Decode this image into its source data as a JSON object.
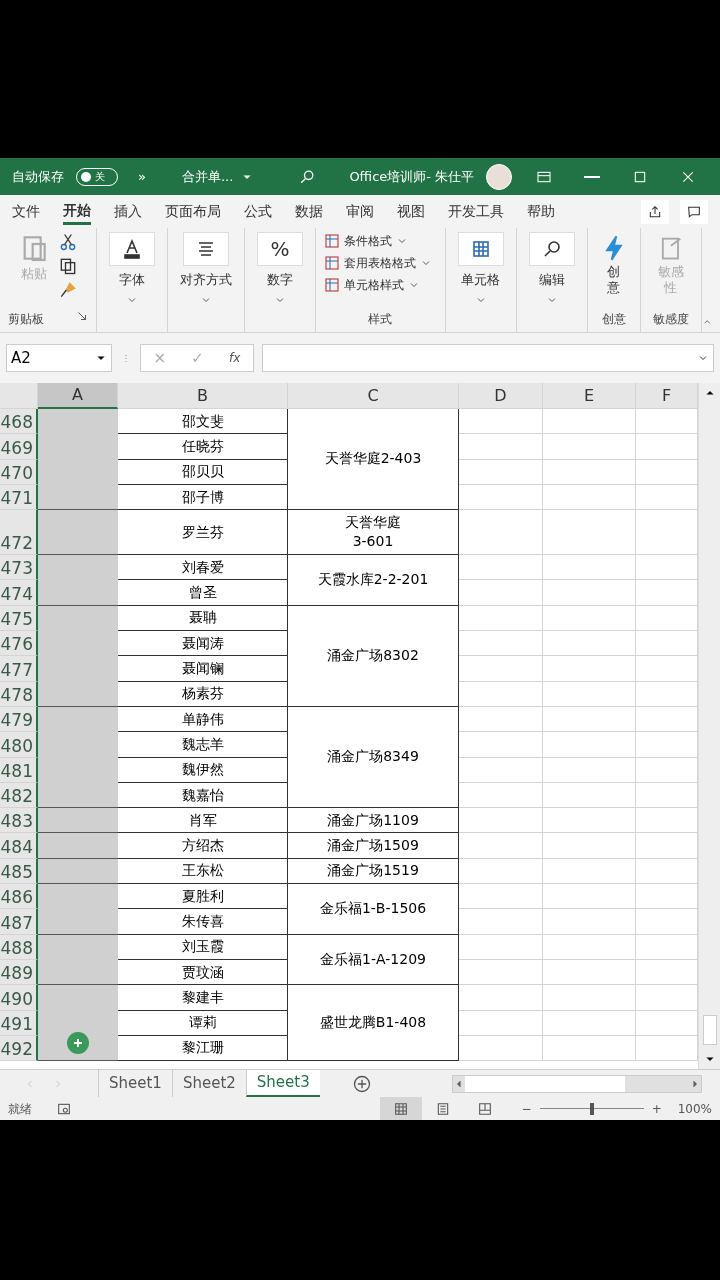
{
  "title_bar": {
    "autosave_label": "自动保存",
    "autosave_on": false,
    "autosave_state": "关",
    "more": "»",
    "file_name": "合并单...",
    "title": "Office培训师- 朱仕平"
  },
  "menu_tabs": [
    {
      "label": "文件",
      "selected": false
    },
    {
      "label": "开始",
      "selected": true
    },
    {
      "label": "插入",
      "selected": false
    },
    {
      "label": "页面布局",
      "selected": false
    },
    {
      "label": "公式",
      "selected": false
    },
    {
      "label": "数据",
      "selected": false
    },
    {
      "label": "审阅",
      "selected": false
    },
    {
      "label": "视图",
      "selected": false
    },
    {
      "label": "开发工具",
      "selected": false
    },
    {
      "label": "帮助",
      "selected": false
    }
  ],
  "ribbon": {
    "clipboard": {
      "paste": "粘贴",
      "paste_disabled": true,
      "label": "剪贴板"
    },
    "single_groups": [
      {
        "kind": "font",
        "label": "字体"
      },
      {
        "kind": "align",
        "label": "对齐方式"
      },
      {
        "kind": "number",
        "label": "数字",
        "symbol": "%"
      }
    ],
    "styles": {
      "items": [
        "条件格式",
        "套用表格格式",
        "单元格样式"
      ],
      "label": "样式"
    },
    "tail_groups": [
      {
        "kind": "cells",
        "label": "单元格"
      },
      {
        "kind": "edit",
        "label": "编辑"
      }
    ],
    "creative": {
      "button": [
        "创",
        "意"
      ],
      "label": "创意"
    },
    "sensitivity": {
      "button": [
        "敏感",
        "性"
      ],
      "disabled": true,
      "label": "敏感度"
    }
  },
  "formula_bar": {
    "name_box": "A2",
    "cancel": "×",
    "enter": "✓",
    "fx": "fx"
  },
  "columns": [
    {
      "label": "A",
      "selected": true
    },
    {
      "label": "B",
      "selected": false
    },
    {
      "label": "C",
      "selected": false
    },
    {
      "label": "D",
      "selected": false
    },
    {
      "label": "E",
      "selected": false
    },
    {
      "label": "F",
      "selected": false
    }
  ],
  "groups": [
    {
      "address": "天誉华庭2-403",
      "rows": [
        {
          "num": "468",
          "name": "邵文斐"
        },
        {
          "num": "469",
          "name": "任晓芬"
        },
        {
          "num": "470",
          "name": "邵贝贝"
        },
        {
          "num": "471",
          "name": "邵子博"
        }
      ]
    },
    {
      "address": "天誉华庭\n3-601",
      "tall": true,
      "rows": [
        {
          "num": "472",
          "name": "罗兰芬"
        }
      ]
    },
    {
      "address": "天霞水库2-2-201",
      "rows": [
        {
          "num": "473",
          "name": "刘春爱"
        },
        {
          "num": "474",
          "name": "曾圣"
        }
      ]
    },
    {
      "address": "涌金广场8302",
      "rows": [
        {
          "num": "475",
          "name": "聂聃"
        },
        {
          "num": "476",
          "name": "聂闻涛"
        },
        {
          "num": "477",
          "name": "聂闻镧"
        },
        {
          "num": "478",
          "name": "杨素芬"
        }
      ]
    },
    {
      "address": "涌金广场8349",
      "rows": [
        {
          "num": "479",
          "name": "单静伟"
        },
        {
          "num": "480",
          "name": "魏志羊"
        },
        {
          "num": "481",
          "name": "魏伊然"
        },
        {
          "num": "482",
          "name": "魏嘉怡"
        }
      ]
    },
    {
      "address": "涌金广场1109",
      "rows": [
        {
          "num": "483",
          "name": "肖军"
        }
      ]
    },
    {
      "address": "涌金广场1509",
      "rows": [
        {
          "num": "484",
          "name": "方绍杰"
        }
      ]
    },
    {
      "address": "涌金广场1519",
      "rows": [
        {
          "num": "485",
          "name": "王东松"
        }
      ]
    },
    {
      "address": "金乐福1-B-1506",
      "rows": [
        {
          "num": "486",
          "name": "夏胜利"
        },
        {
          "num": "487",
          "name": "朱传喜"
        }
      ]
    },
    {
      "address": "金乐福1-A-1209",
      "rows": [
        {
          "num": "488",
          "name": "刘玉霞"
        },
        {
          "num": "489",
          "name": "贾玟涵"
        }
      ]
    },
    {
      "address": "盛世龙腾B1-408",
      "cursor": true,
      "rows": [
        {
          "num": "490",
          "name": "黎建丰"
        },
        {
          "num": "491",
          "name": "谭莉"
        },
        {
          "num": "492",
          "name": "黎江珊"
        }
      ]
    }
  ],
  "sheet_tabs": [
    {
      "label": "Sheet1",
      "selected": false
    },
    {
      "label": "Sheet2",
      "selected": false
    },
    {
      "label": "Sheet3",
      "selected": true
    }
  ],
  "status_bar": {
    "status": "就绪",
    "views": [
      {
        "kind": "normal",
        "selected": true
      },
      {
        "kind": "layout",
        "selected": false
      },
      {
        "kind": "break",
        "selected": false
      }
    ],
    "zoom_minus": "−",
    "zoom_plus": "+",
    "zoom": {
      "level": 0.5
    },
    "zoom_text": "100%"
  }
}
